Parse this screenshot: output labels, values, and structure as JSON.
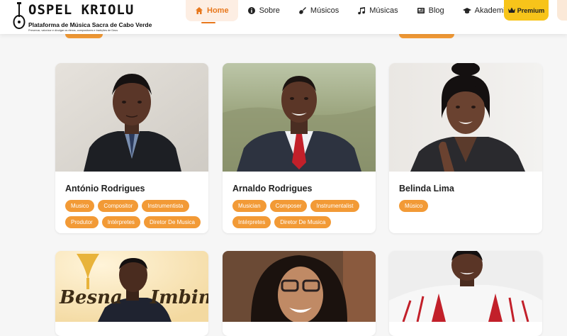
{
  "header": {
    "brand": "OSPEL KRIOLU",
    "tagline": "Plataforma de Música Sacra de Cabo Verde",
    "tagline_small": "Preservar, valorizar e divulgar os ritmos, compositores e tradições de Deus",
    "menu": [
      {
        "label": "Home",
        "icon": "home-icon",
        "active": true
      },
      {
        "label": "Sobre",
        "icon": "info-icon"
      },
      {
        "label": "Músicos",
        "icon": "guitar-icon"
      },
      {
        "label": "Músicas",
        "icon": "music-note-icon"
      },
      {
        "label": "Blog",
        "icon": "newspaper-icon"
      },
      {
        "label": "Akademia",
        "icon": "graduation-cap-icon"
      }
    ],
    "premium": "Premium"
  },
  "accent_color": "#f29a36",
  "premium_color": "#f7c41a",
  "musicians": [
    {
      "name": "António Rodrigues",
      "tags": [
        "Musico",
        "Compositor",
        "Instrumentista",
        "Produtor",
        "Intérpretes",
        "Diretor De Musica"
      ]
    },
    {
      "name": "Arnaldo Rodrigues",
      "tags": [
        "Musician",
        "Composer",
        "Instrumentalist",
        "Intérpretes",
        "Diretor De Musica"
      ]
    },
    {
      "name": "Belinda Lima",
      "tags": [
        "Músico"
      ]
    },
    {
      "name": "",
      "photo_text": [
        "Besna",
        "Imbine"
      ],
      "tags": []
    },
    {
      "name": "",
      "tags": []
    },
    {
      "name": "",
      "tags": []
    }
  ]
}
